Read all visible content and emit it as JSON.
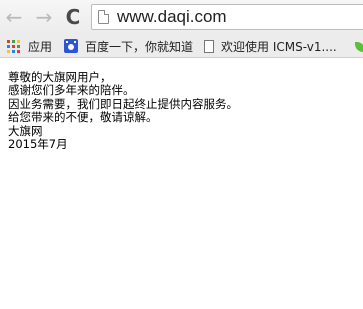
{
  "colors": {
    "apps_grid": [
      "#e53935",
      "#43a047",
      "#fbc02d",
      "#1e88e5",
      "#e53935",
      "#43a047",
      "#fbc02d",
      "#1e88e5",
      "#e53935"
    ]
  },
  "toolbar": {
    "url": "www.daqi.com",
    "icons": [
      "back-arrow",
      "forward-arrow",
      "reload",
      "page"
    ]
  },
  "bookmarks": {
    "items": [
      {
        "label": "应用",
        "icon": "apps-grid"
      },
      {
        "label": "百度一下，你就知道",
        "icon": "baidu-paw"
      },
      {
        "label": "欢迎使用 ICMS-v1....",
        "icon": "document"
      }
    ],
    "overflow_icon": "leaf"
  },
  "page": {
    "lines": [
      "尊敬的大旗网用户，",
      "感谢您们多年来的陪伴。",
      "因业务需要，我们即日起终止提供内容服务。",
      "给您带来的不便，敬请谅解。",
      "大旗网",
      "2015年7月"
    ]
  }
}
